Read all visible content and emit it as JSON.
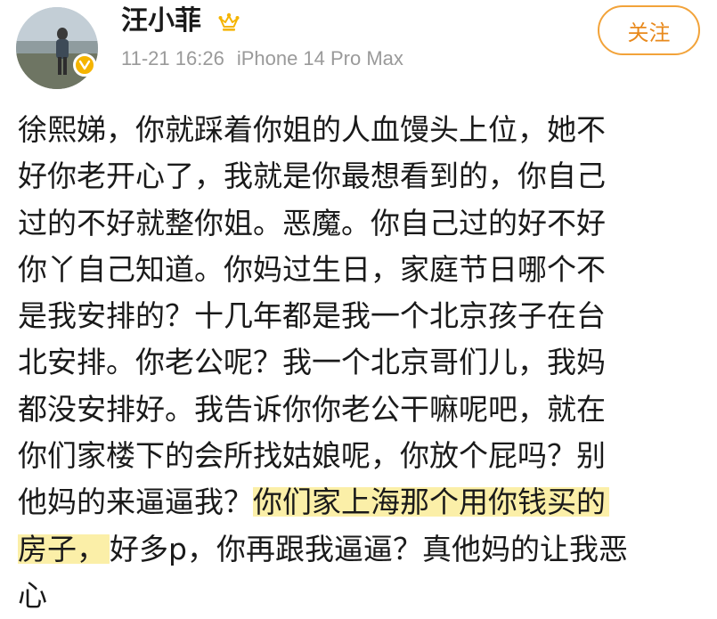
{
  "post": {
    "username": "汪小菲",
    "timestamp": "11-21 16:26",
    "device": "iPhone 14 Pro Max",
    "follow_label": "关注",
    "badges": {
      "crown": "crown-icon",
      "verified": "verified-icon"
    },
    "colors": {
      "accent": "#f2a33a",
      "highlight": "#fbefa8",
      "meta": "#9a9a9a"
    },
    "lines": [
      "徐熙娣，你就踩着你姐的人血馒头上位，她不",
      "好你老开心了，我就是你最想看到的，你自己",
      "过的不好就整你姐。恶魔。你自己过的好不好",
      "你丫自己知道。你妈过生日，家庭节日哪个不",
      "是我安排的？十几年都是我一个北京孩子在台",
      "北安排。你老公呢？我一个北京哥们儿，我妈",
      "都没安排好。我告诉你你老公干嘛呢吧，就在",
      "你们家楼下的会所找姑娘呢，你放个屁吗？别"
    ],
    "line9_plain": "他妈的来逼逼我？",
    "line9_highlight": "你们家上海那个用你钱买的",
    "line10_highlight": "房子，",
    "line10_plain": "好多p，你再跟我逼逼？真他妈的让我恶",
    "line11": "心"
  }
}
